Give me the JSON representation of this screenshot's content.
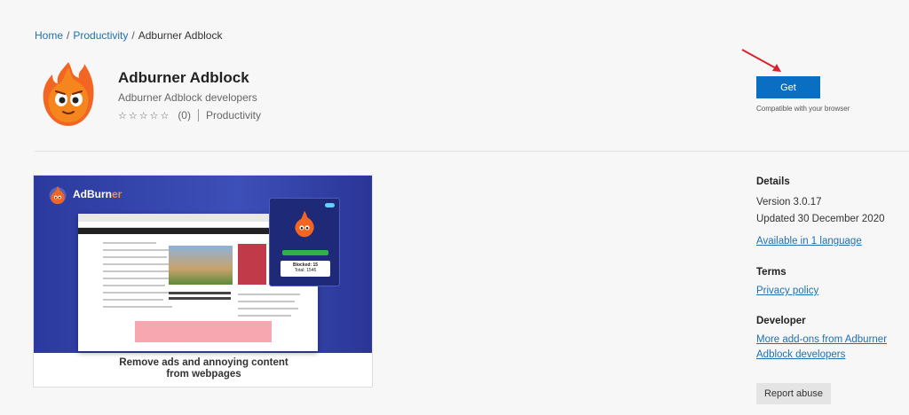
{
  "breadcrumb": {
    "home": "Home",
    "category": "Productivity",
    "current": "Adburner Adblock",
    "separator": "/"
  },
  "extension": {
    "name": "Adburner Adblock",
    "developer": "Adburner Adblock developers",
    "stars": "☆☆☆☆☆",
    "rating_count": "(0)",
    "category": "Productivity"
  },
  "actions": {
    "get_label": "Get",
    "compat_text": "Compatible with your browser",
    "report_label": "Report abuse"
  },
  "screenshot": {
    "brand_prefix": "AdBurn",
    "brand_suffix": "er",
    "caption_line1": "Remove ads and annoying content",
    "caption_line2": "from webpages",
    "popup_blocked": "Blocked: 15",
    "popup_total": "Total: 1546"
  },
  "details": {
    "heading": "Details",
    "version": "Version 3.0.17",
    "updated": "Updated 30 December 2020",
    "languages_link": "Available in 1 language"
  },
  "terms": {
    "heading": "Terms",
    "privacy_link": "Privacy policy"
  },
  "developer_section": {
    "heading": "Developer",
    "more_link_line1": "More add-ons from Adburner",
    "more_link_line2": "Adblock developers"
  },
  "colors": {
    "accent": "#0a6fc2",
    "link": "#1f6fb2",
    "annotation_arrow": "#d9232e",
    "screenshot_bg": "#2b3a9e"
  }
}
